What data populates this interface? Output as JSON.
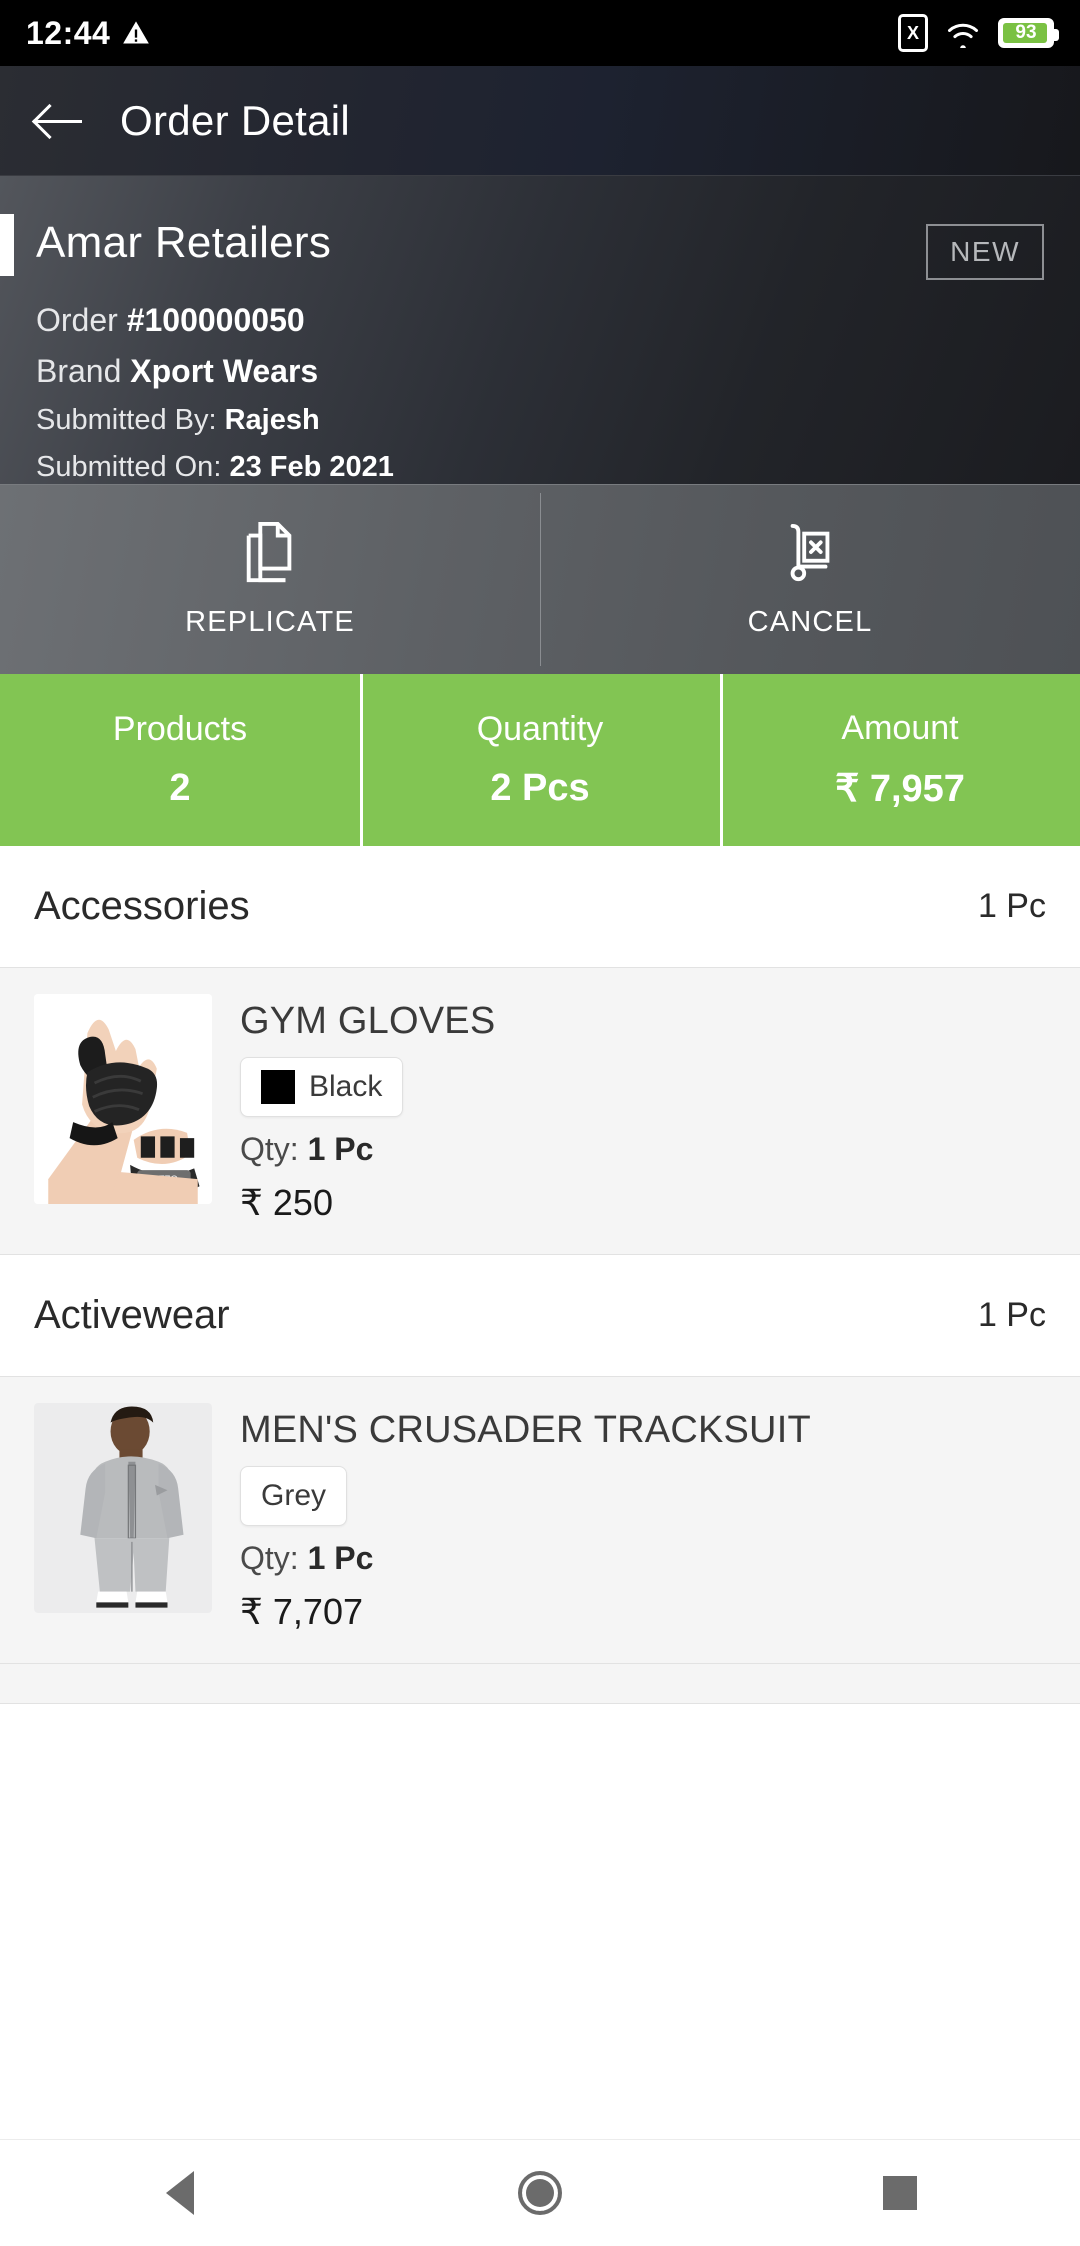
{
  "statusbar": {
    "time": "12:44",
    "warning_icon": "warning-triangle-icon",
    "sim_icon_label": "X",
    "wifi_icon": "wifi-icon",
    "battery_percent": "93"
  },
  "appbar": {
    "back_icon": "back-arrow-icon",
    "title": "Order Detail"
  },
  "order": {
    "business_name": "Amar Retailers",
    "status_badge": "NEW",
    "order_label": "Order",
    "order_number": "#100000050",
    "brand_label": "Brand",
    "brand_value": "Xport Wears",
    "submitted_by_label": "Submitted By:",
    "submitted_by_value": "Rajesh",
    "submitted_on_label": "Submitted On:",
    "submitted_on_value": "23 Feb 2021"
  },
  "actions": [
    {
      "label": "REPLICATE",
      "icon": "copy-documents-icon"
    },
    {
      "label": "CANCEL",
      "icon": "hand-truck-cancel-icon"
    }
  ],
  "stats": [
    {
      "label": "Products",
      "value": "2"
    },
    {
      "label": "Quantity",
      "value": "2 Pcs"
    },
    {
      "label": "Amount",
      "value": "₹ 7,957"
    }
  ],
  "categories": [
    {
      "name": "Accessories",
      "qty": "1 Pc",
      "products": [
        {
          "name": "GYM GLOVES",
          "color_label": "Black",
          "color_hex": "#000000",
          "has_swatch": true,
          "qty_label": "Qty:",
          "qty_value": "1 Pc",
          "price": "₹ 250",
          "image": "gym-gloves-photo"
        }
      ]
    },
    {
      "name": "Activewear",
      "qty": "1 Pc",
      "products": [
        {
          "name": "MEN'S CRUSADER TRACKSUIT",
          "color_label": "Grey",
          "color_hex": "#a8a8a8",
          "has_swatch": false,
          "qty_label": "Qty:",
          "qty_value": "1 Pc",
          "price": "₹ 7,707",
          "image": "mens-tracksuit-photo"
        }
      ]
    }
  ],
  "theme": {
    "accent_green": "#82c553",
    "appbar_bg": "#22242b",
    "panel_bg": "#2c2f36",
    "action_bg": "#5e6165"
  },
  "navbar": {
    "back_icon": "nav-back-icon",
    "home_icon": "nav-home-icon",
    "recents_icon": "nav-recents-icon"
  }
}
